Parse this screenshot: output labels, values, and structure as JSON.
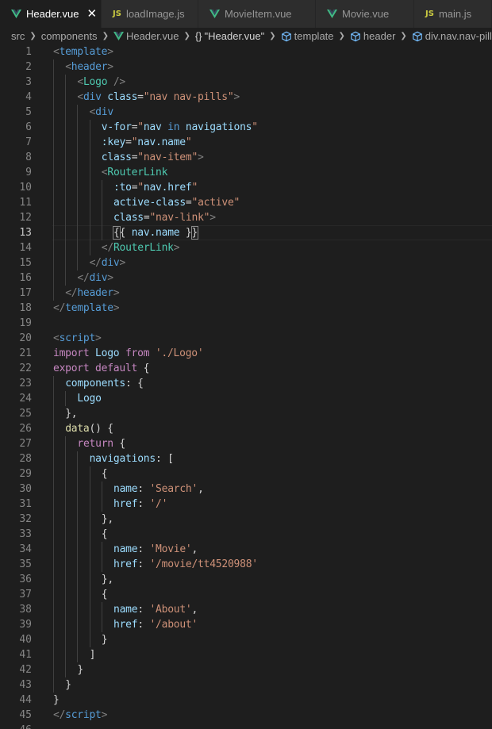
{
  "tabs": [
    {
      "label": "Header.vue",
      "icon": "vue-icon",
      "active": true
    },
    {
      "label": "loadImage.js",
      "icon": "js-icon",
      "active": false
    },
    {
      "label": "MovieItem.vue",
      "icon": "vue-icon",
      "active": false
    },
    {
      "label": "Movie.vue",
      "icon": "vue-icon",
      "active": false
    },
    {
      "label": "main.js",
      "icon": "js-icon",
      "active": false
    }
  ],
  "breadcrumb": [
    "src",
    "components",
    "Header.vue",
    "\"Header.vue\"",
    "template",
    "header",
    "div.nav.nav-pills"
  ],
  "editor": {
    "current_line": 13,
    "lines": [
      [
        [
          "br",
          "<"
        ],
        [
          "tag",
          "template"
        ],
        [
          "br",
          ">"
        ]
      ],
      [
        [
          "br",
          "<"
        ],
        [
          "tag",
          "header"
        ],
        [
          "br",
          ">"
        ]
      ],
      [
        [
          "br",
          "<"
        ],
        [
          "comp",
          "Logo"
        ],
        [
          "plain",
          " "
        ],
        [
          "br",
          "/>"
        ]
      ],
      [
        [
          "br",
          "<"
        ],
        [
          "tag",
          "div"
        ],
        [
          "plain",
          " "
        ],
        [
          "attr",
          "class"
        ],
        [
          "plain",
          "="
        ],
        [
          "str",
          "\"nav nav-pills\""
        ],
        [
          "br",
          ">"
        ]
      ],
      [
        [
          "br",
          "<"
        ],
        [
          "tag",
          "div"
        ]
      ],
      [
        [
          "attr",
          "v-for"
        ],
        [
          "plain",
          "="
        ],
        [
          "str",
          "\""
        ],
        [
          "var",
          "nav"
        ],
        [
          "plain",
          " "
        ],
        [
          "ctl",
          "in"
        ],
        [
          "plain",
          " "
        ],
        [
          "var",
          "navigations"
        ],
        [
          "str",
          "\""
        ]
      ],
      [
        [
          "attr",
          ":key"
        ],
        [
          "plain",
          "="
        ],
        [
          "str",
          "\""
        ],
        [
          "var",
          "nav.name"
        ],
        [
          "str",
          "\""
        ]
      ],
      [
        [
          "attr",
          "class"
        ],
        [
          "plain",
          "="
        ],
        [
          "str",
          "\"nav-item\""
        ],
        [
          "br",
          ">"
        ]
      ],
      [
        [
          "br",
          "<"
        ],
        [
          "comp",
          "RouterLink"
        ]
      ],
      [
        [
          "attr",
          ":to"
        ],
        [
          "plain",
          "="
        ],
        [
          "str",
          "\""
        ],
        [
          "var",
          "nav.href"
        ],
        [
          "str",
          "\""
        ]
      ],
      [
        [
          "attr",
          "active-class"
        ],
        [
          "plain",
          "="
        ],
        [
          "str",
          "\"active\""
        ]
      ],
      [
        [
          "attr",
          "class"
        ],
        [
          "plain",
          "="
        ],
        [
          "str",
          "\"nav-link\""
        ],
        [
          "br",
          ">"
        ]
      ],
      [
        [
          "bracket",
          "{"
        ],
        [
          "plain",
          "{ "
        ],
        [
          "var",
          "nav.name"
        ],
        [
          "plain",
          " }"
        ],
        [
          "bracket",
          "}"
        ]
      ],
      [
        [
          "br",
          "</"
        ],
        [
          "comp",
          "RouterLink"
        ],
        [
          "br",
          ">"
        ]
      ],
      [
        [
          "br",
          "</"
        ],
        [
          "tag",
          "div"
        ],
        [
          "br",
          ">"
        ]
      ],
      [
        [
          "br",
          "</"
        ],
        [
          "tag",
          "div"
        ],
        [
          "br",
          ">"
        ]
      ],
      [
        [
          "br",
          "</"
        ],
        [
          "tag",
          "header"
        ],
        [
          "br",
          ">"
        ]
      ],
      [
        [
          "br",
          "</"
        ],
        [
          "tag",
          "template"
        ],
        [
          "br",
          ">"
        ]
      ],
      [],
      [
        [
          "br",
          "<"
        ],
        [
          "tag",
          "script"
        ],
        [
          "br",
          ">"
        ]
      ],
      [
        [
          "kw",
          "import"
        ],
        [
          "plain",
          " "
        ],
        [
          "var",
          "Logo"
        ],
        [
          "plain",
          " "
        ],
        [
          "kw",
          "from"
        ],
        [
          "plain",
          " "
        ],
        [
          "str",
          "'./Logo'"
        ]
      ],
      [
        [
          "kw",
          "export"
        ],
        [
          "plain",
          " "
        ],
        [
          "kw",
          "default"
        ],
        [
          "plain",
          " {"
        ]
      ],
      [
        [
          "var",
          "components"
        ],
        [
          "plain",
          ": {"
        ]
      ],
      [
        [
          "var",
          "Logo"
        ]
      ],
      [
        [
          "plain",
          "},"
        ]
      ],
      [
        [
          "fn",
          "data"
        ],
        [
          "plain",
          "() {"
        ]
      ],
      [
        [
          "kw",
          "return"
        ],
        [
          "plain",
          " {"
        ]
      ],
      [
        [
          "var",
          "navigations"
        ],
        [
          "plain",
          ": ["
        ]
      ],
      [
        [
          "plain",
          "{"
        ]
      ],
      [
        [
          "var",
          "name"
        ],
        [
          "plain",
          ": "
        ],
        [
          "str",
          "'Search'"
        ],
        [
          "plain",
          ","
        ]
      ],
      [
        [
          "var",
          "href"
        ],
        [
          "plain",
          ": "
        ],
        [
          "str",
          "'/'"
        ]
      ],
      [
        [
          "plain",
          "},"
        ]
      ],
      [
        [
          "plain",
          "{"
        ]
      ],
      [
        [
          "var",
          "name"
        ],
        [
          "plain",
          ": "
        ],
        [
          "str",
          "'Movie'"
        ],
        [
          "plain",
          ","
        ]
      ],
      [
        [
          "var",
          "href"
        ],
        [
          "plain",
          ": "
        ],
        [
          "str",
          "'/movie/tt4520988'"
        ]
      ],
      [
        [
          "plain",
          "},"
        ]
      ],
      [
        [
          "plain",
          "{"
        ]
      ],
      [
        [
          "var",
          "name"
        ],
        [
          "plain",
          ": "
        ],
        [
          "str",
          "'About'"
        ],
        [
          "plain",
          ","
        ]
      ],
      [
        [
          "var",
          "href"
        ],
        [
          "plain",
          ": "
        ],
        [
          "str",
          "'/about'"
        ]
      ],
      [
        [
          "plain",
          "}"
        ]
      ],
      [
        [
          "plain",
          "]"
        ]
      ],
      [
        [
          "plain",
          "}"
        ]
      ],
      [
        [
          "plain",
          "}"
        ]
      ],
      [
        [
          "plain",
          "}"
        ]
      ],
      [
        [
          "br",
          "</"
        ],
        [
          "tag",
          "script"
        ],
        [
          "br",
          ">"
        ]
      ],
      []
    ]
  },
  "colors": {
    "background": "#1e1e1e",
    "vue_icon": "#41b883",
    "js_icon": "#cbcb41",
    "tag": "#569cd6",
    "component": "#4ec9b0",
    "attribute": "#9cdcfe",
    "string": "#ce9178",
    "keyword": "#c586c0"
  }
}
